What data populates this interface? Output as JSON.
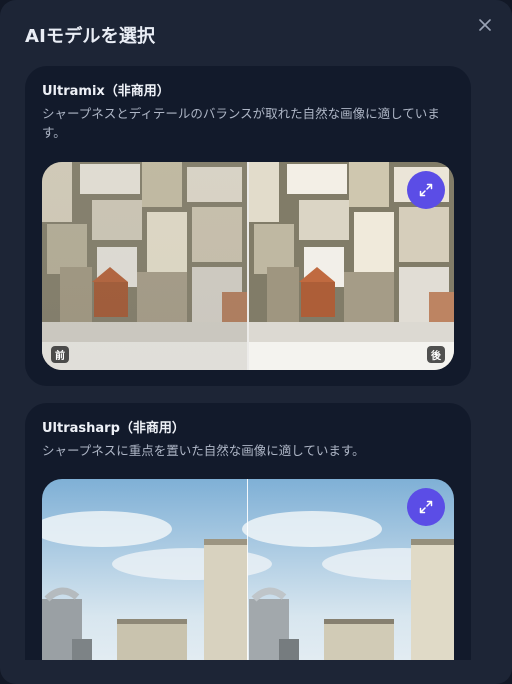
{
  "dialog": {
    "title": "AIモデルを選択",
    "close_icon": "close-icon"
  },
  "models": [
    {
      "name": "Ultramix（非商用）",
      "description": "シャープネスとディテールのバランスが取れた自然な画像に適しています。",
      "before_label": "前",
      "after_label": "後",
      "expand_icon": "expand-icon"
    },
    {
      "name": "Ultrasharp（非商用）",
      "description": "シャープネスに重点を置いた自然な画像に適しています。",
      "expand_icon": "expand-icon"
    }
  ],
  "colors": {
    "dialog_bg": "#1d2536",
    "card_bg": "#121a2b",
    "accent": "#5b4de6"
  }
}
